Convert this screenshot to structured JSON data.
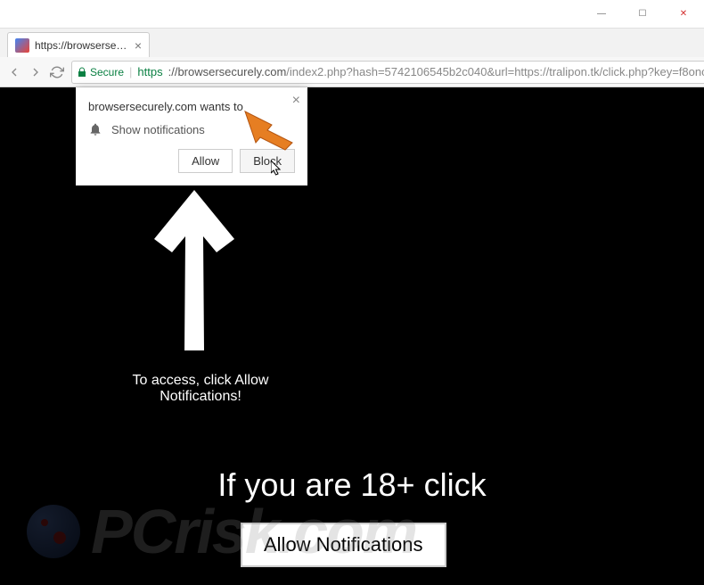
{
  "window": {
    "minimize": "—",
    "maximize": "☐",
    "close": "✕"
  },
  "tab": {
    "title": "https://browsersecurely.c",
    "close": "×"
  },
  "addressbar": {
    "secure_label": "Secure",
    "url_protocol": "https",
    "url_host": "://browsersecurely.com",
    "url_path": "/index2.php?hash=5742106545b2c040&url=https://tralipon.tk/click.php?key=f8oncxh3s..."
  },
  "notification": {
    "title": "browsersecurely.com wants to",
    "body": "Show notifications",
    "allow": "Allow",
    "block": "Block",
    "close": "×"
  },
  "page": {
    "access_text": "To access, click Allow Notifications!",
    "headline": "If you are 18+ click",
    "allow_button": "Allow Notifications"
  },
  "watermark": {
    "text": "PCrisk.com"
  }
}
